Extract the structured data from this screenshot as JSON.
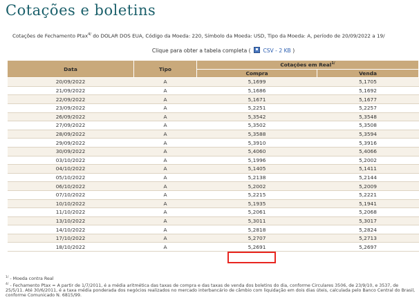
{
  "page": {
    "title": "Cotações e boletins"
  },
  "description": {
    "prefix": "Cotações de Fechamento Ptax",
    "sup": "4/",
    "suffix": " do DOLAR DOS EUA, Código da Moeda: 220, Símbolo da Moeda: USD, Tipo da Moeda: A, período de 20/09/2022 a 19/"
  },
  "download": {
    "text": "Clique para obter a tabela completa (",
    "link": "CSV - 2 KB",
    "close": ")"
  },
  "table": {
    "headers": {
      "date": "Data",
      "type": "Tipo",
      "group": "Cotações em Real",
      "group_sup": "1/",
      "buy": "Compra",
      "sell": "Venda"
    },
    "rows": [
      {
        "date": "20/09/2022",
        "type": "A",
        "buy": "5,1699",
        "sell": "5,1705"
      },
      {
        "date": "21/09/2022",
        "type": "A",
        "buy": "5,1686",
        "sell": "5,1692"
      },
      {
        "date": "22/09/2022",
        "type": "A",
        "buy": "5,1671",
        "sell": "5,1677"
      },
      {
        "date": "23/09/2022",
        "type": "A",
        "buy": "5,2251",
        "sell": "5,2257"
      },
      {
        "date": "26/09/2022",
        "type": "A",
        "buy": "5,3542",
        "sell": "5,3548"
      },
      {
        "date": "27/09/2022",
        "type": "A",
        "buy": "5,3502",
        "sell": "5,3508"
      },
      {
        "date": "28/09/2022",
        "type": "A",
        "buy": "5,3588",
        "sell": "5,3594"
      },
      {
        "date": "29/09/2022",
        "type": "A",
        "buy": "5,3910",
        "sell": "5,3916"
      },
      {
        "date": "30/09/2022",
        "type": "A",
        "buy": "5,4060",
        "sell": "5,4066"
      },
      {
        "date": "03/10/2022",
        "type": "A",
        "buy": "5,1996",
        "sell": "5,2002"
      },
      {
        "date": "04/10/2022",
        "type": "A",
        "buy": "5,1405",
        "sell": "5,1411"
      },
      {
        "date": "05/10/2022",
        "type": "A",
        "buy": "5,2138",
        "sell": "5,2144"
      },
      {
        "date": "06/10/2022",
        "type": "A",
        "buy": "5,2002",
        "sell": "5,2009"
      },
      {
        "date": "07/10/2022",
        "type": "A",
        "buy": "5,2215",
        "sell": "5,2221"
      },
      {
        "date": "10/10/2022",
        "type": "A",
        "buy": "5,1935",
        "sell": "5,1941"
      },
      {
        "date": "11/10/2022",
        "type": "A",
        "buy": "5,2061",
        "sell": "5,2068"
      },
      {
        "date": "13/10/2022",
        "type": "A",
        "buy": "5,3011",
        "sell": "5,3017"
      },
      {
        "date": "14/10/2022",
        "type": "A",
        "buy": "5,2818",
        "sell": "5,2824"
      },
      {
        "date": "17/10/2022",
        "type": "A",
        "buy": "5,2707",
        "sell": "5,2713"
      },
      {
        "date": "18/10/2022",
        "type": "A",
        "buy": "5,2691",
        "sell": "5,2697"
      }
    ]
  },
  "footnotes": {
    "note1_sup": "1/",
    "note1": " - Moeda contra Real",
    "note4_sup": "4/",
    "note4": " - Fechamento Ptax = A partir de 1/7/2011, é a média aritmética das taxas de compra e das taxas de venda dos boletins do dia, conforme Circulares 3506, de 23/9/10, e 3537, de 25/5/11. Até 30/6/2011, é a taxa média ponderada dos negócios realizados no mercado interbancário de câmbio com liquidação em dois dias úteis, calculada pelo Banco Central do Brasil, conforme Comunicado N. 6815/99."
  },
  "colors": {
    "title": "#1a5f6a",
    "header_bg": "#c9a97b",
    "odd_row_bg": "#f6f1e8",
    "highlight_border": "#e8251f",
    "link": "#2a5db0"
  }
}
